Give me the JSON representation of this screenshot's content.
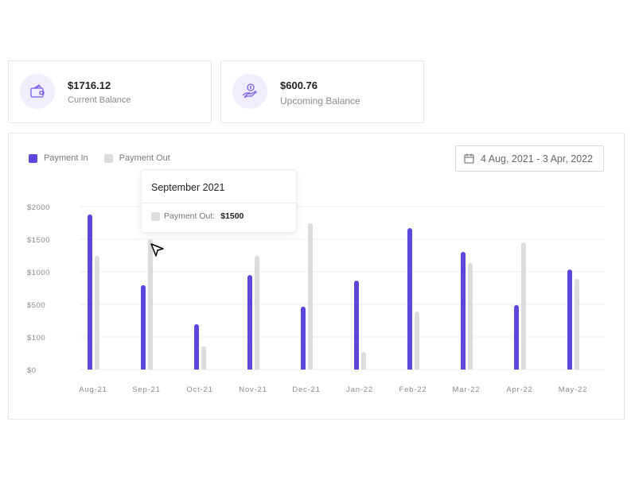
{
  "cards": [
    {
      "amount": "$1716.12",
      "label": "Current Balance",
      "icon": "wallet-icon"
    },
    {
      "amount": "$600.76",
      "label": "Upcoming Balance",
      "icon": "hand-coin-icon"
    }
  ],
  "date_range": {
    "label": "4 Aug, 2021 - 3 Apr, 2022",
    "icon": "calendar-icon"
  },
  "colors": {
    "payment_in": "#5b47db",
    "payment_out": "#dcdcdc",
    "accent_bg": "#f1edfd"
  },
  "tooltip": {
    "title": "September 2021",
    "series": "Payment Out:",
    "value": "$1500"
  },
  "chart_data": {
    "type": "bar",
    "title": "",
    "xlabel": "",
    "ylabel": "",
    "legend": {
      "placement": "top-left",
      "entries": [
        "Payment In",
        "Payment Out"
      ]
    },
    "y_ticks": [
      0,
      100,
      500,
      1000,
      1500,
      2000
    ],
    "y_tick_labels": [
      "$0",
      "$100",
      "$500",
      "$1000",
      "$1500",
      "$2000"
    ],
    "ylim": [
      0,
      2000
    ],
    "grid": true,
    "categories": [
      "Aug-21",
      "Sep-21",
      "Oct-21",
      "Nov-21",
      "Dec-21",
      "Jan-22",
      "Feb-22",
      "Mar-22",
      "Apr-22",
      "May-22"
    ],
    "series": [
      {
        "name": "Payment In",
        "values": [
          1880,
          795,
          256,
          950,
          472,
          865,
          1670,
          1305,
          492,
          1035
        ]
      },
      {
        "name": "Payment Out",
        "values": [
          1245,
          1500,
          71,
          1245,
          1745,
          54,
          412,
          1135,
          1450,
          890
        ]
      }
    ]
  }
}
